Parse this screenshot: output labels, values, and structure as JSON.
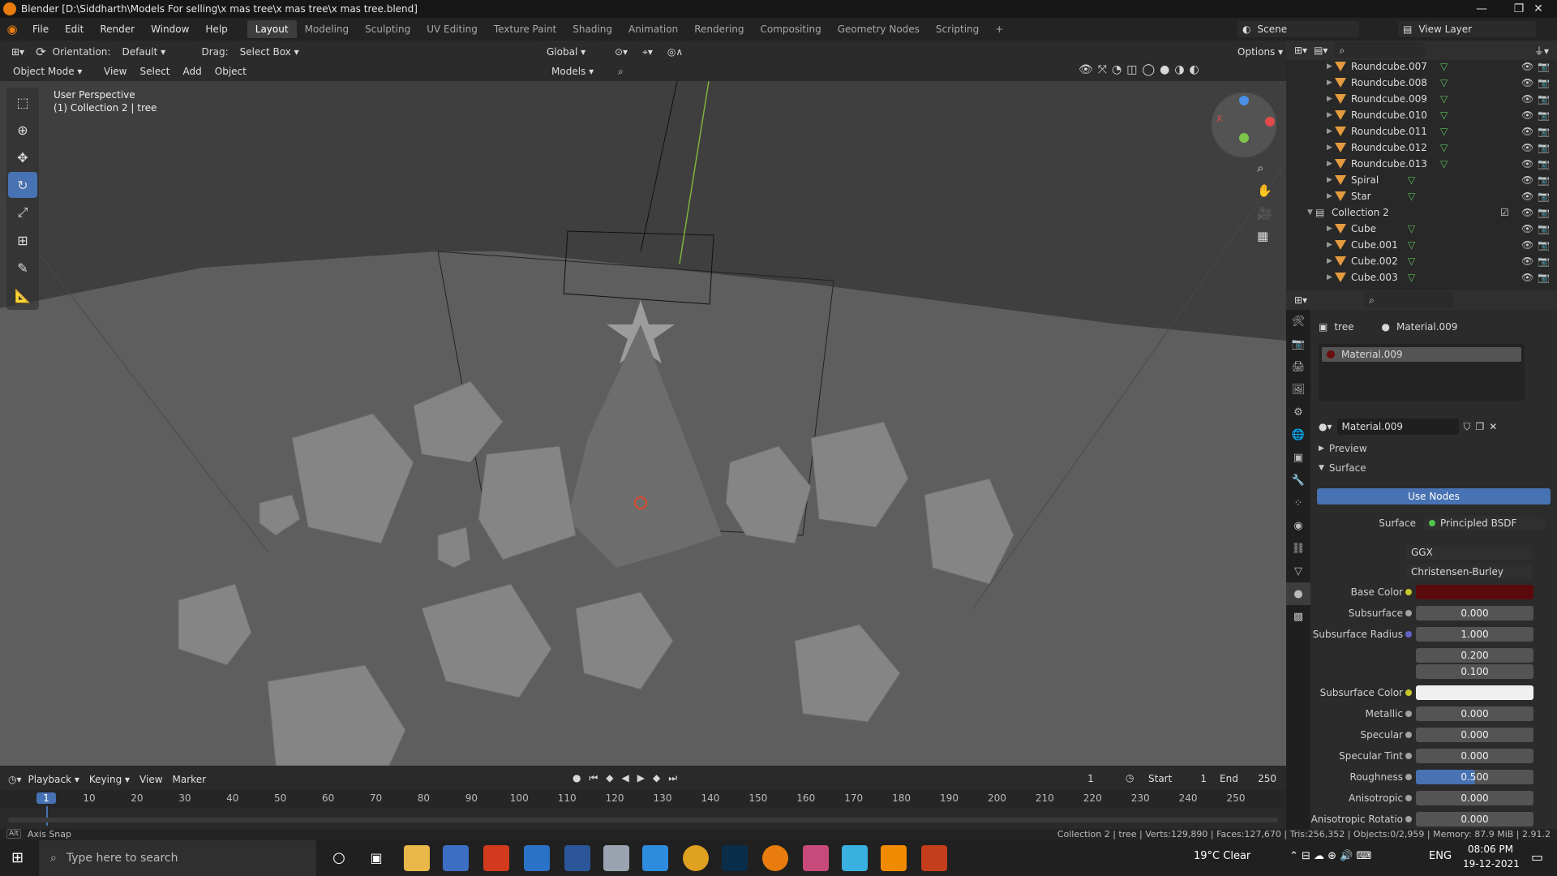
{
  "window": {
    "title": "Blender [D:\\Siddharth\\Models For selling\\x mas tree\\x mas tree\\x mas tree.blend]"
  },
  "menu": [
    "File",
    "Edit",
    "Render",
    "Window",
    "Help"
  ],
  "workspaces": [
    "Layout",
    "Modeling",
    "Sculpting",
    "UV Editing",
    "Texture Paint",
    "Shading",
    "Animation",
    "Rendering",
    "Compositing",
    "Geometry Nodes",
    "Scripting"
  ],
  "scene": {
    "label": "Scene",
    "view_layer": "View Layer"
  },
  "header": {
    "orientation_label": "Orientation:",
    "orientation_value": "Default",
    "drag_label": "Drag:",
    "drag_value": "Select Box",
    "transform": "Global",
    "options": "Options",
    "mode": "Object Mode",
    "menus": [
      "View",
      "Select",
      "Add",
      "Object"
    ],
    "collection_filter": "Models"
  },
  "viewport": {
    "perspective": "User Perspective",
    "context": "(1) Collection 2 | tree"
  },
  "outliner": {
    "rows": [
      {
        "name": "Roundcube.007",
        "indent": 1
      },
      {
        "name": "Roundcube.008",
        "indent": 1
      },
      {
        "name": "Roundcube.009",
        "indent": 1
      },
      {
        "name": "Roundcube.010",
        "indent": 1
      },
      {
        "name": "Roundcube.011",
        "indent": 1
      },
      {
        "name": "Roundcube.012",
        "indent": 1
      },
      {
        "name": "Roundcube.013",
        "indent": 1
      },
      {
        "name": "Spiral",
        "indent": 1
      },
      {
        "name": "Star",
        "indent": 1
      },
      {
        "name": "Collection 2",
        "indent": 0
      },
      {
        "name": "Cube",
        "indent": 1
      },
      {
        "name": "Cube.001",
        "indent": 1
      },
      {
        "name": "Cube.002",
        "indent": 1
      },
      {
        "name": "Cube.003",
        "indent": 1
      }
    ]
  },
  "properties": {
    "breadcrumb_object": "tree",
    "breadcrumb_material": "Material.009",
    "slot": "Material.009",
    "datablock": "Material.009",
    "panels": {
      "preview": "Preview",
      "surface": "Surface"
    },
    "use_nodes": "Use Nodes",
    "surface_label": "Surface",
    "surface_value": "Principled BSDF",
    "distribution": "GGX",
    "subsurface_method": "Christensen-Burley",
    "fields": [
      {
        "label": "Base Color",
        "value": "",
        "color": "#5a0a0a",
        "dot": "#c7c729"
      },
      {
        "label": "Subsurface",
        "value": "0.000",
        "dot": "#a1a1a1"
      },
      {
        "label": "Subsurface Radius",
        "value": "1.000",
        "dot": "#6363c7"
      },
      {
        "label": "",
        "value": "0.200"
      },
      {
        "label": "",
        "value": "0.100"
      },
      {
        "label": "Subsurface Color",
        "value": "",
        "color": "#f0f0f0",
        "dot": "#c7c729"
      },
      {
        "label": "Metallic",
        "value": "0.000",
        "dot": "#a1a1a1"
      },
      {
        "label": "Specular",
        "value": "0.000",
        "dot": "#a1a1a1"
      },
      {
        "label": "Specular Tint",
        "value": "0.000",
        "dot": "#a1a1a1"
      },
      {
        "label": "Roughness",
        "value": "0.500",
        "dot": "#a1a1a1",
        "fill": 0.5
      },
      {
        "label": "Anisotropic",
        "value": "0.000",
        "dot": "#a1a1a1"
      },
      {
        "label": "Anisotropic Rotatio",
        "value": "0.000",
        "dot": "#a1a1a1"
      }
    ]
  },
  "timeline": {
    "menus": [
      "Playback",
      "Keying",
      "View",
      "Marker"
    ],
    "current": "1",
    "start_label": "Start",
    "start": "1",
    "end_label": "End",
    "end": "250",
    "ticks": [
      "1",
      "10",
      "20",
      "30",
      "40",
      "50",
      "60",
      "70",
      "80",
      "90",
      "100",
      "110",
      "120",
      "130",
      "140",
      "150",
      "160",
      "170",
      "180",
      "190",
      "200",
      "210",
      "220",
      "230",
      "240",
      "250"
    ]
  },
  "status": {
    "left": "Axis Snap",
    "key": "Alt",
    "right": "Collection 2 | tree | Verts:129,890 | Faces:127,670 | Tris:256,352 | Objects:0/2,959 | Memory: 87.9 MiB | 2.91.2"
  },
  "taskbar": {
    "search": "Type here to search",
    "weather": "19°C  Clear",
    "lang": "ENG",
    "time": "08:06 PM",
    "date": "19-12-2021"
  }
}
